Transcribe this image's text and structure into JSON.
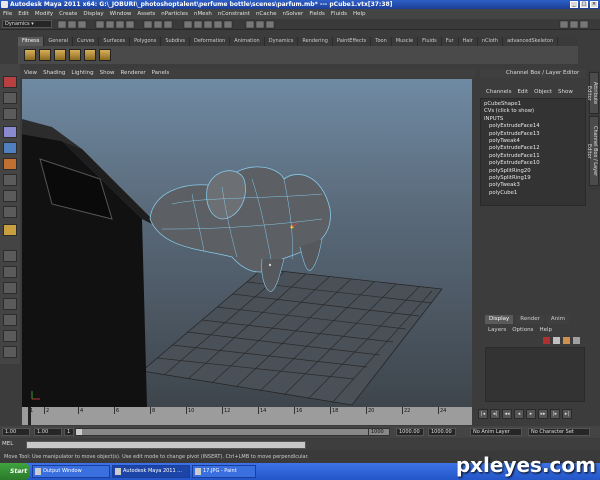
{
  "window": {
    "title": "Autodesk Maya 2011 x64: G:\\_JOBURI\\_photoshoptalent\\perfume bottle\\scenes\\parfum.mb* --- pCube1.vtx[37:38]"
  },
  "menubar": [
    "File",
    "Edit",
    "Modify",
    "Create",
    "Display",
    "Window",
    "Assets",
    "nParticles",
    "nMesh",
    "nConstraint",
    "nCache",
    "nSolver",
    "Fields",
    "Fluids",
    "Help"
  ],
  "status_line": {
    "mode": "Dynamics"
  },
  "shelf": {
    "tabs": [
      "Fitness",
      "General",
      "Curves",
      "Surfaces",
      "Polygons",
      "Subdivs",
      "Deformation",
      "Animation",
      "Dynamics",
      "Rendering",
      "PaintEffects",
      "Toon",
      "Muscle",
      "Fluids",
      "Fur",
      "Hair",
      "nCloth",
      "advancedSkeleton"
    ],
    "active_tab": "Fitness"
  },
  "viewport": {
    "menu": [
      "View",
      "Shading",
      "Lighting",
      "Show",
      "Renderer",
      "Panels"
    ]
  },
  "channel_box": {
    "header": "Channel Box / Layer Editor",
    "menu": [
      "Channels",
      "Edit",
      "Object",
      "Show"
    ],
    "shape": "pCubeShape1",
    "cvs": "CVs (click to show)",
    "inputs_label": "INPUTS",
    "inputs": [
      "polyExtrudeFace14",
      "polyExtrudeFace13",
      "polyTweak4",
      "polyExtrudeFace12",
      "polyExtrudeFace11",
      "polyExtrudeFace10",
      "polySplitRing20",
      "polySplitRing19",
      "polyTweak3",
      "polyCube1"
    ]
  },
  "side_tabs": [
    "Attribute Editor",
    "Channel Box / Layer Editor"
  ],
  "layer_editor": {
    "tabs": [
      "Display",
      "Render",
      "Anim"
    ],
    "active_tab": "Display",
    "menu": [
      "Layers",
      "Options",
      "Help"
    ]
  },
  "time_slider": {
    "ticks": [
      "1",
      "2",
      "4",
      "6",
      "8",
      "10",
      "12",
      "14",
      "16",
      "18",
      "20",
      "22",
      "24"
    ]
  },
  "range": {
    "start": "1.00",
    "current": "1.00",
    "inner_start": "1",
    "inner_end": "1000",
    "end": "1000.00",
    "total": "1000.00",
    "anim_layer": "No Anim Layer",
    "character_set": "No Character Set"
  },
  "mel": {
    "label": "MEL"
  },
  "help_line": "Move Tool: Use manipulator to move object(s). Use edit mode to change pivot (INSERT). Ctrl+LMB to move perpendicular.",
  "taskbar": {
    "start": "Start",
    "tasks": [
      "Output Window",
      "Autodesk Maya 2011 ...",
      "17.JPG - Paint"
    ]
  },
  "watermark": "pxleyes.com"
}
